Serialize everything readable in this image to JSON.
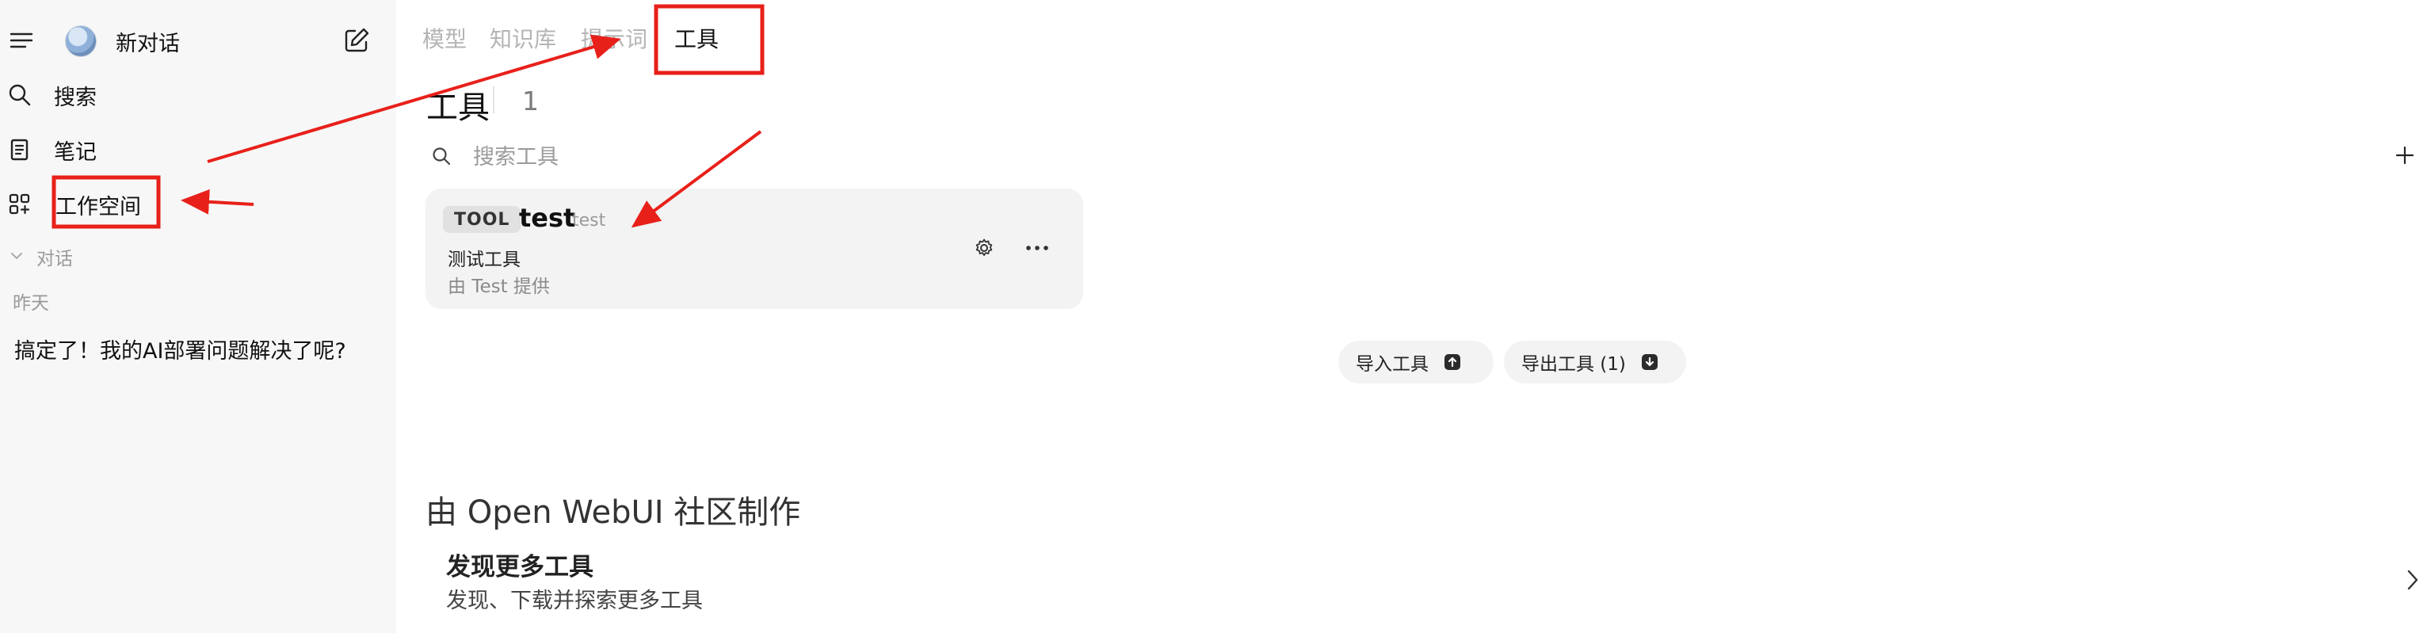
{
  "sidebar": {
    "new_chat_label": "新对话",
    "items": [
      {
        "label": "搜索",
        "icon": "search-icon"
      },
      {
        "label": "笔记",
        "icon": "notes-icon"
      },
      {
        "label": "工作空间",
        "icon": "workspace-icon"
      }
    ],
    "section_label": "对话",
    "group_label": "昨天",
    "chats": [
      {
        "title": "搞定了！我的AI部署问题解决了呢?"
      }
    ]
  },
  "tabs": [
    {
      "label": "模型",
      "active": false
    },
    {
      "label": "知识库",
      "active": false
    },
    {
      "label": "提示词",
      "active": false
    },
    {
      "label": "工具",
      "active": true
    }
  ],
  "page": {
    "title": "工具",
    "count": "1",
    "search_placeholder": "搜索工具"
  },
  "tools": [
    {
      "badge": "TOOL",
      "name": "test",
      "id": "test",
      "description": "测试工具",
      "author": "由 Test 提供"
    }
  ],
  "actions": {
    "import_label": "导入工具",
    "export_label": "导出工具 (1)"
  },
  "community": {
    "title": "由 Open WebUI 社区制作",
    "discover_title": "发现更多工具",
    "discover_subtitle": "发现、下载并探索更多工具"
  },
  "colors": {
    "sidebar_bg": "#f7f7f7",
    "card_bg": "#f3f3f3",
    "annotation_red": "#e8201a"
  }
}
